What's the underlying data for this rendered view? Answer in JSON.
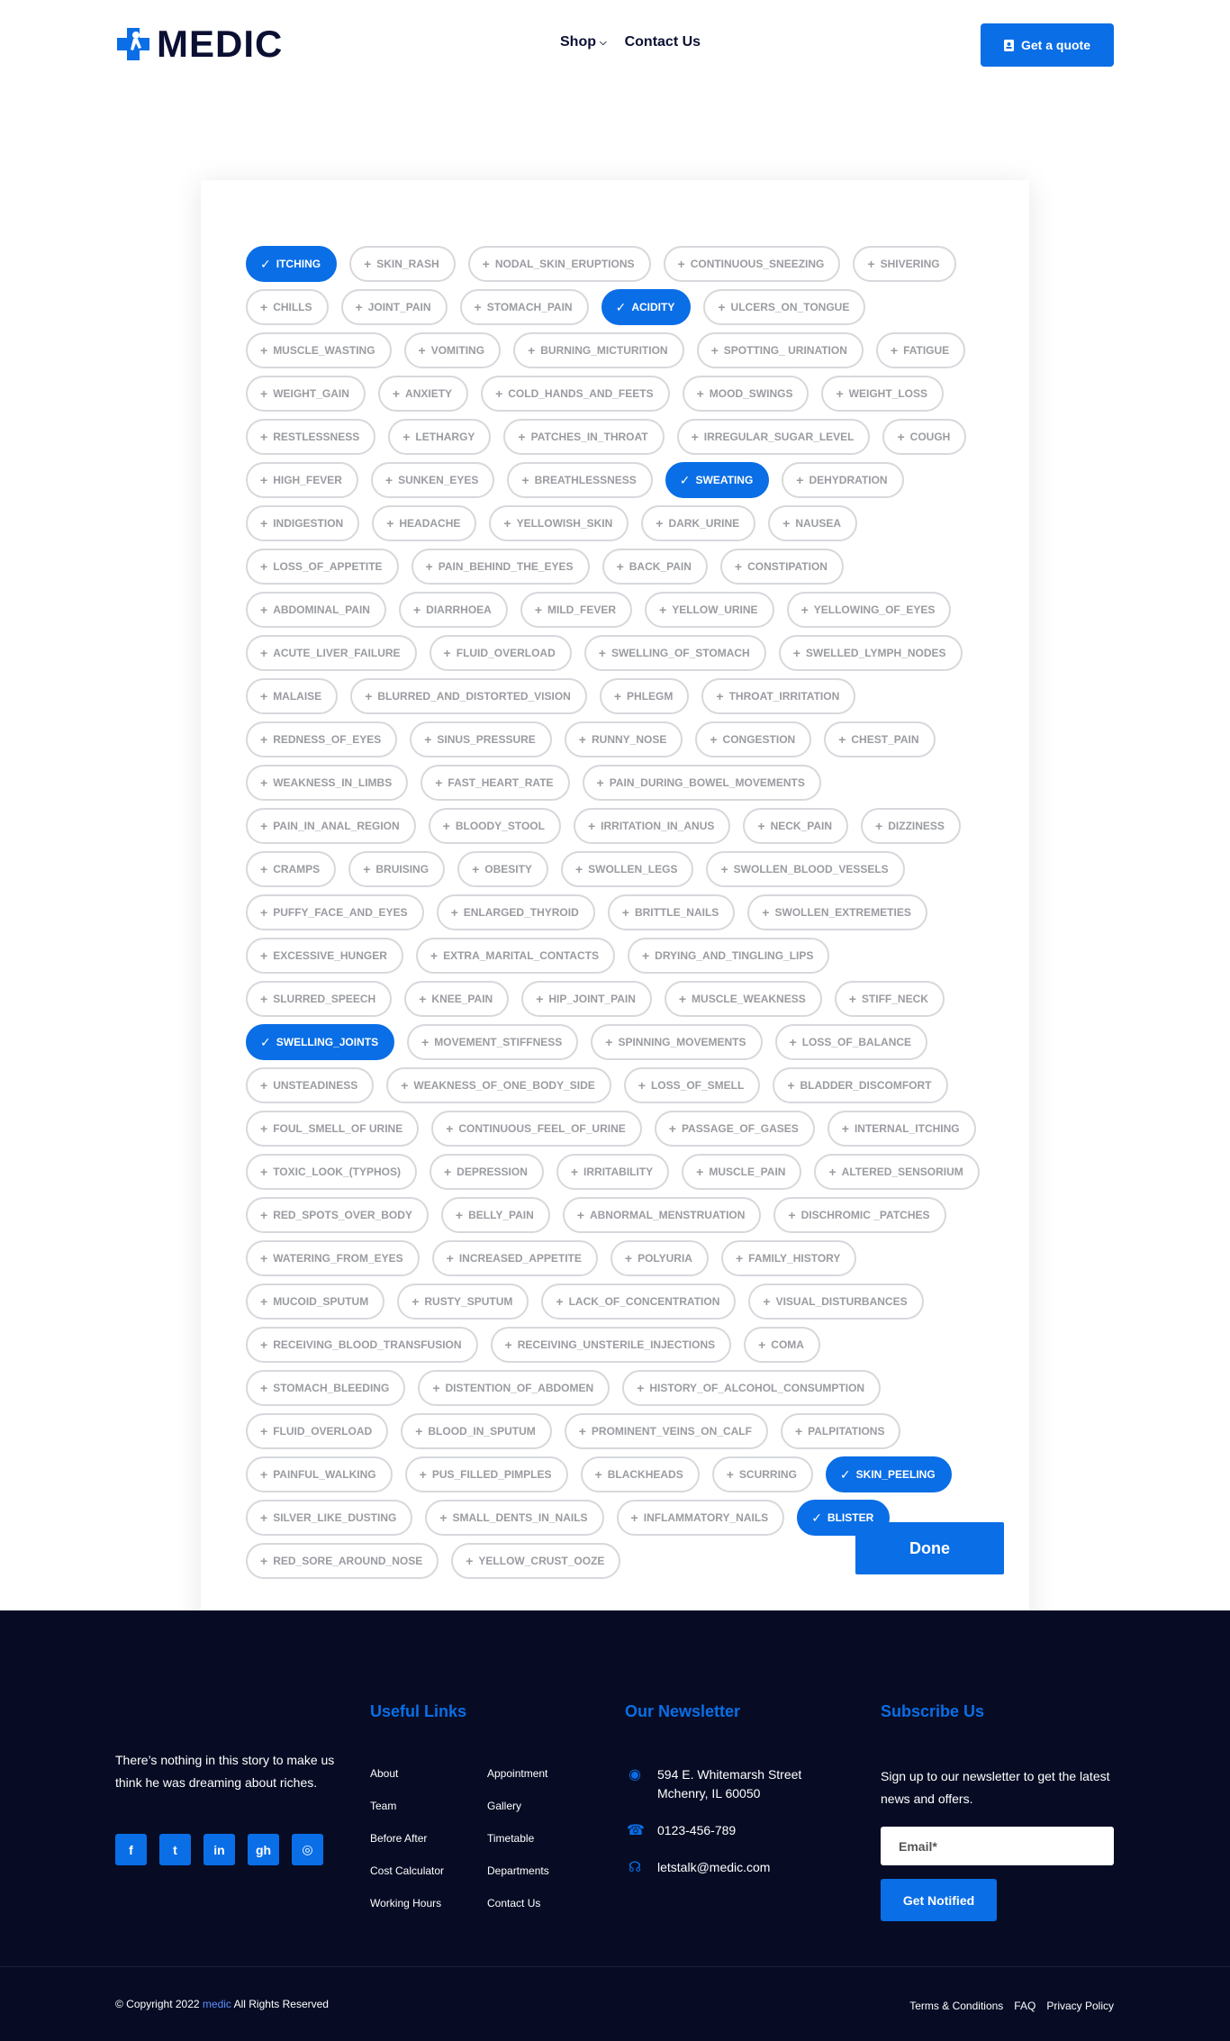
{
  "header": {
    "logo_text": "MEDIC",
    "nav": {
      "shop": "Shop",
      "contact": "Contact Us"
    },
    "quote_button": "Get a quote"
  },
  "symptoms": [
    {
      "label": "ITCHING",
      "selected": true
    },
    {
      "label": "SKIN_RASH",
      "selected": false
    },
    {
      "label": "NODAL_SKIN_ERUPTIONS",
      "selected": false
    },
    {
      "label": "CONTINUOUS_SNEEZING",
      "selected": false
    },
    {
      "label": "SHIVERING",
      "selected": false
    },
    {
      "label": "CHILLS",
      "selected": false
    },
    {
      "label": "JOINT_PAIN",
      "selected": false
    },
    {
      "label": "STOMACH_PAIN",
      "selected": false
    },
    {
      "label": "ACIDITY",
      "selected": true
    },
    {
      "label": "ULCERS_ON_TONGUE",
      "selected": false
    },
    {
      "label": "MUSCLE_WASTING",
      "selected": false
    },
    {
      "label": "VOMITING",
      "selected": false
    },
    {
      "label": "BURNING_MICTURITION",
      "selected": false
    },
    {
      "label": "SPOTTING_ URINATION",
      "selected": false
    },
    {
      "label": "FATIGUE",
      "selected": false
    },
    {
      "label": "WEIGHT_GAIN",
      "selected": false
    },
    {
      "label": "ANXIETY",
      "selected": false
    },
    {
      "label": "COLD_HANDS_AND_FEETS",
      "selected": false
    },
    {
      "label": "MOOD_SWINGS",
      "selected": false
    },
    {
      "label": "WEIGHT_LOSS",
      "selected": false
    },
    {
      "label": "RESTLESSNESS",
      "selected": false
    },
    {
      "label": "LETHARGY",
      "selected": false
    },
    {
      "label": "PATCHES_IN_THROAT",
      "selected": false
    },
    {
      "label": "IRREGULAR_SUGAR_LEVEL",
      "selected": false
    },
    {
      "label": "COUGH",
      "selected": false
    },
    {
      "label": "HIGH_FEVER",
      "selected": false
    },
    {
      "label": "SUNKEN_EYES",
      "selected": false
    },
    {
      "label": "BREATHLESSNESS",
      "selected": false
    },
    {
      "label": "SWEATING",
      "selected": true
    },
    {
      "label": "DEHYDRATION",
      "selected": false
    },
    {
      "label": "INDIGESTION",
      "selected": false
    },
    {
      "label": "HEADACHE",
      "selected": false
    },
    {
      "label": "YELLOWISH_SKIN",
      "selected": false
    },
    {
      "label": "DARK_URINE",
      "selected": false
    },
    {
      "label": "NAUSEA",
      "selected": false
    },
    {
      "label": "LOSS_OF_APPETITE",
      "selected": false
    },
    {
      "label": "PAIN_BEHIND_THE_EYES",
      "selected": false
    },
    {
      "label": "BACK_PAIN",
      "selected": false
    },
    {
      "label": "CONSTIPATION",
      "selected": false
    },
    {
      "label": "ABDOMINAL_PAIN",
      "selected": false
    },
    {
      "label": "DIARRHOEA",
      "selected": false
    },
    {
      "label": "MILD_FEVER",
      "selected": false
    },
    {
      "label": "YELLOW_URINE",
      "selected": false
    },
    {
      "label": "YELLOWING_OF_EYES",
      "selected": false
    },
    {
      "label": "ACUTE_LIVER_FAILURE",
      "selected": false
    },
    {
      "label": "FLUID_OVERLOAD",
      "selected": false
    },
    {
      "label": "SWELLING_OF_STOMACH",
      "selected": false
    },
    {
      "label": "SWELLED_LYMPH_NODES",
      "selected": false
    },
    {
      "label": "MALAISE",
      "selected": false
    },
    {
      "label": "BLURRED_AND_DISTORTED_VISION",
      "selected": false
    },
    {
      "label": "PHLEGM",
      "selected": false
    },
    {
      "label": "THROAT_IRRITATION",
      "selected": false
    },
    {
      "label": "REDNESS_OF_EYES",
      "selected": false
    },
    {
      "label": "SINUS_PRESSURE",
      "selected": false
    },
    {
      "label": "RUNNY_NOSE",
      "selected": false
    },
    {
      "label": "CONGESTION",
      "selected": false
    },
    {
      "label": "CHEST_PAIN",
      "selected": false
    },
    {
      "label": "WEAKNESS_IN_LIMBS",
      "selected": false
    },
    {
      "label": "FAST_HEART_RATE",
      "selected": false
    },
    {
      "label": "PAIN_DURING_BOWEL_MOVEMENTS",
      "selected": false
    },
    {
      "label": "PAIN_IN_ANAL_REGION",
      "selected": false
    },
    {
      "label": "BLOODY_STOOL",
      "selected": false
    },
    {
      "label": "IRRITATION_IN_ANUS",
      "selected": false
    },
    {
      "label": "NECK_PAIN",
      "selected": false
    },
    {
      "label": "DIZZINESS",
      "selected": false
    },
    {
      "label": "CRAMPS",
      "selected": false
    },
    {
      "label": "BRUISING",
      "selected": false
    },
    {
      "label": "OBESITY",
      "selected": false
    },
    {
      "label": "SWOLLEN_LEGS",
      "selected": false
    },
    {
      "label": "SWOLLEN_BLOOD_VESSELS",
      "selected": false
    },
    {
      "label": "PUFFY_FACE_AND_EYES",
      "selected": false
    },
    {
      "label": "ENLARGED_THYROID",
      "selected": false
    },
    {
      "label": "BRITTLE_NAILS",
      "selected": false
    },
    {
      "label": "SWOLLEN_EXTREMETIES",
      "selected": false
    },
    {
      "label": "EXCESSIVE_HUNGER",
      "selected": false
    },
    {
      "label": "EXTRA_MARITAL_CONTACTS",
      "selected": false
    },
    {
      "label": "DRYING_AND_TINGLING_LIPS",
      "selected": false
    },
    {
      "label": "SLURRED_SPEECH",
      "selected": false
    },
    {
      "label": "KNEE_PAIN",
      "selected": false
    },
    {
      "label": "HIP_JOINT_PAIN",
      "selected": false
    },
    {
      "label": "MUSCLE_WEAKNESS",
      "selected": false
    },
    {
      "label": "STIFF_NECK",
      "selected": false
    },
    {
      "label": "SWELLING_JOINTS",
      "selected": true
    },
    {
      "label": "MOVEMENT_STIFFNESS",
      "selected": false
    },
    {
      "label": "SPINNING_MOVEMENTS",
      "selected": false
    },
    {
      "label": "LOSS_OF_BALANCE",
      "selected": false
    },
    {
      "label": "UNSTEADINESS",
      "selected": false
    },
    {
      "label": "WEAKNESS_OF_ONE_BODY_SIDE",
      "selected": false
    },
    {
      "label": "LOSS_OF_SMELL",
      "selected": false
    },
    {
      "label": "BLADDER_DISCOMFORT",
      "selected": false
    },
    {
      "label": "FOUL_SMELL_OF URINE",
      "selected": false
    },
    {
      "label": "CONTINUOUS_FEEL_OF_URINE",
      "selected": false
    },
    {
      "label": "PASSAGE_OF_GASES",
      "selected": false
    },
    {
      "label": "INTERNAL_ITCHING",
      "selected": false
    },
    {
      "label": "TOXIC_LOOK_(TYPHOS)",
      "selected": false
    },
    {
      "label": "DEPRESSION",
      "selected": false
    },
    {
      "label": "IRRITABILITY",
      "selected": false
    },
    {
      "label": "MUSCLE_PAIN",
      "selected": false
    },
    {
      "label": "ALTERED_SENSORIUM",
      "selected": false
    },
    {
      "label": "RED_SPOTS_OVER_BODY",
      "selected": false
    },
    {
      "label": "BELLY_PAIN",
      "selected": false
    },
    {
      "label": "ABNORMAL_MENSTRUATION",
      "selected": false
    },
    {
      "label": "DISCHROMIC _PATCHES",
      "selected": false
    },
    {
      "label": "WATERING_FROM_EYES",
      "selected": false
    },
    {
      "label": "INCREASED_APPETITE",
      "selected": false
    },
    {
      "label": "POLYURIA",
      "selected": false
    },
    {
      "label": "FAMILY_HISTORY",
      "selected": false
    },
    {
      "label": "MUCOID_SPUTUM",
      "selected": false
    },
    {
      "label": "RUSTY_SPUTUM",
      "selected": false
    },
    {
      "label": "LACK_OF_CONCENTRATION",
      "selected": false
    },
    {
      "label": "VISUAL_DISTURBANCES",
      "selected": false
    },
    {
      "label": "RECEIVING_BLOOD_TRANSFUSION",
      "selected": false
    },
    {
      "label": "RECEIVING_UNSTERILE_INJECTIONS",
      "selected": false
    },
    {
      "label": "COMA",
      "selected": false
    },
    {
      "label": "STOMACH_BLEEDING",
      "selected": false
    },
    {
      "label": "DISTENTION_OF_ABDOMEN",
      "selected": false
    },
    {
      "label": "HISTORY_OF_ALCOHOL_CONSUMPTION",
      "selected": false
    },
    {
      "label": "FLUID_OVERLOAD",
      "selected": false
    },
    {
      "label": "BLOOD_IN_SPUTUM",
      "selected": false
    },
    {
      "label": "PROMINENT_VEINS_ON_CALF",
      "selected": false
    },
    {
      "label": "PALPITATIONS",
      "selected": false
    },
    {
      "label": "PAINFUL_WALKING",
      "selected": false
    },
    {
      "label": "PUS_FILLED_PIMPLES",
      "selected": false
    },
    {
      "label": "BLACKHEADS",
      "selected": false
    },
    {
      "label": "SCURRING",
      "selected": false
    },
    {
      "label": "SKIN_PEELING",
      "selected": true
    },
    {
      "label": "SILVER_LIKE_DUSTING",
      "selected": false
    },
    {
      "label": "SMALL_DENTS_IN_NAILS",
      "selected": false
    },
    {
      "label": "INFLAMMATORY_NAILS",
      "selected": false
    },
    {
      "label": "BLISTER",
      "selected": true
    },
    {
      "label": "RED_SORE_AROUND_NOSE",
      "selected": false
    },
    {
      "label": "YELLOW_CRUST_OOZE",
      "selected": false
    }
  ],
  "done_button": "Done",
  "footer": {
    "about": "There’s nothing in this story to make us think he was dreaming about riches.",
    "socials": [
      {
        "icon": "facebook-icon",
        "glyph": "f"
      },
      {
        "icon": "twitter-icon",
        "glyph": "t"
      },
      {
        "icon": "linkedin-icon",
        "glyph": "in"
      },
      {
        "icon": "github-icon",
        "glyph": "gh"
      },
      {
        "icon": "dribbble-icon",
        "glyph": "◎"
      }
    ],
    "useful_links_title": "Useful Links",
    "links_col1": [
      "About",
      "Team",
      "Before After",
      "Cost Calculator",
      "Working Hours"
    ],
    "links_col2": [
      "Appointment",
      "Gallery",
      "Timetable",
      "Departments",
      "Contact Us"
    ],
    "newsletter_title": "Our Newsletter",
    "address_line1": "594 E. Whitemarsh Street",
    "address_line2": "Mchenry, IL 60050",
    "phone": "0123-456-789",
    "email": "letstalk@medic.com",
    "subscribe_title": "Subscribe Us",
    "subscribe_text": "Sign up to our newsletter to get the latest news and offers.",
    "email_placeholder": "Email*",
    "notify_button": "Get Notified",
    "copyright_prefix": "© Copyright 2022",
    "copyright_brand": "medic",
    "copyright_suffix": "All Rights Reserved",
    "legal": [
      "Terms & Conditions",
      "FAQ",
      "Privacy Policy"
    ]
  },
  "colors": {
    "accent": "#0a6ee6",
    "footer_bg": "#070c24",
    "chip_border": "#d6d8dc",
    "chip_text": "#9a9ca1"
  }
}
